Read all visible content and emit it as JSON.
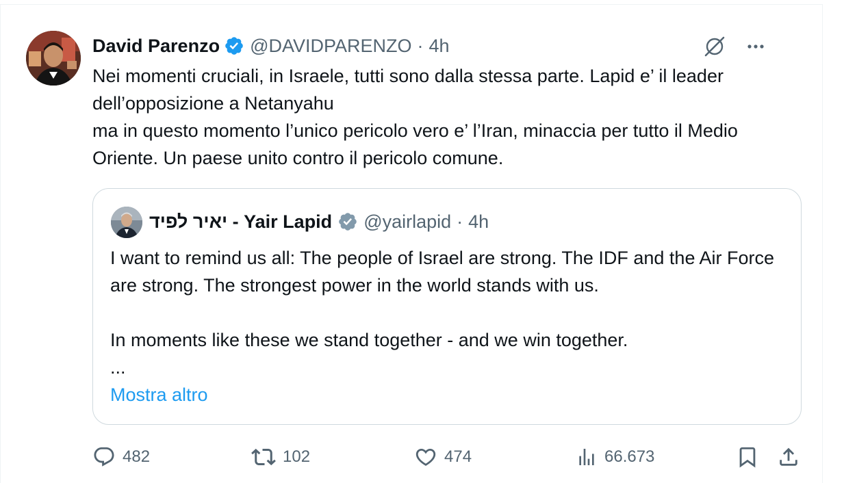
{
  "tweet": {
    "author_name": "David Parenzo",
    "author_handle": "@DAVIDPARENZO",
    "dot": "·",
    "time": "4h",
    "text_lines": [
      "Nei momenti cruciali, in Israele, tutti sono dalla stessa parte. Lapid e’ il leader dell’opposizione a Netanyahu",
      "ma in questo momento l’unico pericolo vero e’ l’Iran, minaccia per tutto il Medio Oriente. Un paese unito contro il pericolo comune."
    ]
  },
  "quote": {
    "author_name": "יאיר לפיד - Yair Lapid",
    "author_handle": "@yairlapid",
    "dot": "·",
    "time": "4h",
    "paragraph1": "I want to remind us all: The people of Israel are strong. The IDF and the Air Force are strong. The strongest power in the world stands with us.",
    "paragraph2": "In moments like these we stand together - and we win together.",
    "ellipsis": "...",
    "show_more": "Mostra altro"
  },
  "actions": {
    "replies": "482",
    "reposts": "102",
    "likes": "474",
    "views": "66.673"
  },
  "colors": {
    "verified": "#1d9bf0",
    "link": "#1d9bf0",
    "secondary": "#536471",
    "border": "#cfd9de"
  },
  "icons": [
    "verified-badge-icon",
    "grok-icon",
    "more-icon",
    "reply-icon",
    "repost-icon",
    "like-icon",
    "views-icon",
    "bookmark-icon",
    "share-icon"
  ]
}
